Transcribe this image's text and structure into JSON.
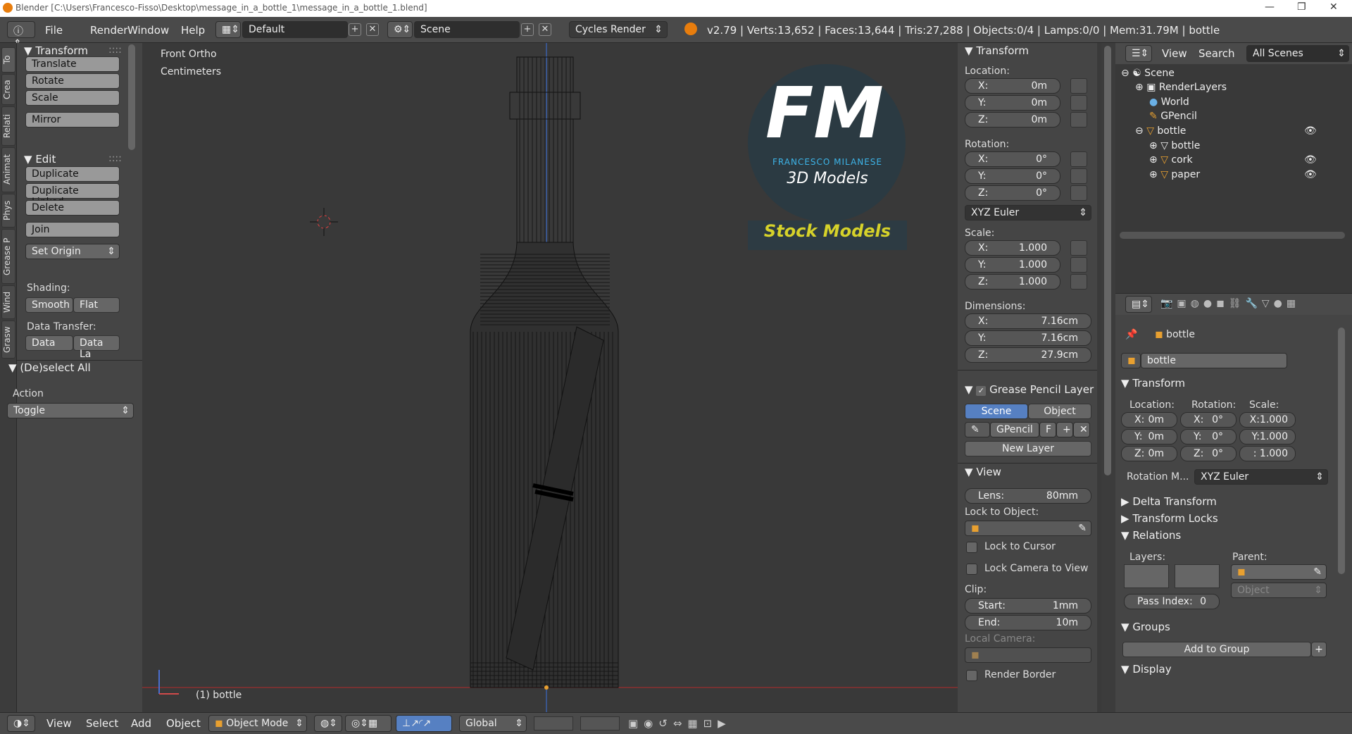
{
  "window": {
    "title": "Blender [C:\\Users\\Francesco-Fisso\\Desktop\\message_in_a_bottle_1\\message_in_a_bottle_1.blend]"
  },
  "header": {
    "menus": [
      "File",
      "Render",
      "Window",
      "Help"
    ],
    "layout": "Default",
    "scene": "Scene",
    "engine": "Cycles Render",
    "stats": "v2.79 | Verts:13,652 | Faces:13,644 | Tris:27,288 | Objects:0/4 | Lamps:0/0 | Mem:31.79M | bottle"
  },
  "tabs": [
    "To",
    "Crea",
    "Relati",
    "Animat",
    "Phys",
    "Grease P",
    "Wind",
    "Grasw"
  ],
  "toolshelf": {
    "transform_title": "Transform",
    "translate": "Translate",
    "rotate": "Rotate",
    "scale": "Scale",
    "mirror": "Mirror",
    "edit_title": "Edit",
    "duplicate": "Duplicate",
    "duplicate_linked": "Duplicate Linked",
    "delete": "Delete",
    "join": "Join",
    "set_origin": "Set Origin",
    "shading_label": "Shading:",
    "smooth": "Smooth",
    "flat": "Flat",
    "data_transfer_label": "Data Transfer:",
    "data": "Data",
    "data_la": "Data La",
    "deselect_title": "(De)select All",
    "action_label": "Action",
    "action_value": "Toggle"
  },
  "viewport": {
    "view_name": "Front Ortho",
    "units": "Centimeters",
    "object_label": "(1) bottle",
    "logo": {
      "letters": "FM",
      "name": "FRANCESCO MILANESE",
      "sub": "3D Models",
      "stock": "Stock Models"
    }
  },
  "npanel": {
    "transform_title": "Transform",
    "location_label": "Location:",
    "loc": [
      {
        "k": "X:",
        "v": "0m"
      },
      {
        "k": "Y:",
        "v": "0m"
      },
      {
        "k": "Z:",
        "v": "0m"
      }
    ],
    "rotation_label": "Rotation:",
    "rot": [
      {
        "k": "X:",
        "v": "0°"
      },
      {
        "k": "Y:",
        "v": "0°"
      },
      {
        "k": "Z:",
        "v": "0°"
      }
    ],
    "rot_mode": "XYZ Euler",
    "scale_label": "Scale:",
    "scl": [
      {
        "k": "X:",
        "v": "1.000"
      },
      {
        "k": "Y:",
        "v": "1.000"
      },
      {
        "k": "Z:",
        "v": "1.000"
      }
    ],
    "dim_label": "Dimensions:",
    "dim": [
      {
        "k": "X:",
        "v": "7.16cm"
      },
      {
        "k": "Y:",
        "v": "7.16cm"
      },
      {
        "k": "Z:",
        "v": "27.9cm"
      }
    ],
    "gp_title": "Grease Pencil Layer",
    "gp_scene": "Scene",
    "gp_object": "Object",
    "gp_name": "GPencil",
    "gp_f": "F",
    "new_layer": "New Layer",
    "view_title": "View",
    "lens_k": "Lens:",
    "lens_v": "80mm",
    "lock_obj": "Lock to Object:",
    "lock_cursor": "Lock to Cursor",
    "lock_camera": "Lock Camera to View",
    "clip_label": "Clip:",
    "start_k": "Start:",
    "start_v": "1mm",
    "end_k": "End:",
    "end_v": "10m",
    "local_camera": "Local Camera:",
    "render_border": "Render Border"
  },
  "outliner": {
    "view": "View",
    "search": "Search",
    "filter": "All Scenes",
    "rows": [
      "Scene",
      "RenderLayers",
      "World",
      "GPencil",
      "bottle",
      "bottle",
      "cork",
      "paper"
    ]
  },
  "properties": {
    "object_name": "bottle",
    "object_field": "bottle",
    "transform_title": "Transform",
    "location_label": "Location:",
    "rotation_label": "Rotation:",
    "scale_label": "Scale:",
    "loc": [
      {
        "k": "X:",
        "v": "0m"
      },
      {
        "k": "Y:",
        "v": "0m"
      },
      {
        "k": "Z:",
        "v": "0m"
      }
    ],
    "rot": [
      {
        "k": "X:",
        "v": "0°"
      },
      {
        "k": "Y:",
        "v": "0°"
      },
      {
        "k": "Z:",
        "v": "0°"
      }
    ],
    "scl": [
      "X:1.000",
      "Y:1.000",
      ": 1.000"
    ],
    "rot_mode_label": "Rotation M...",
    "rot_mode": "XYZ Euler",
    "delta": "Delta Transform",
    "locks": "Transform Locks",
    "relations": "Relations",
    "layers": "Layers:",
    "parent": "Parent:",
    "parent_type": "Object",
    "pass_index_k": "Pass Index:",
    "pass_index_v": "0",
    "groups": "Groups",
    "add_to_group": "Add to Group",
    "display": "Display"
  },
  "footer": {
    "view": "View",
    "select": "Select",
    "add": "Add",
    "object": "Object",
    "mode": "Object Mode",
    "orientation": "Global"
  }
}
